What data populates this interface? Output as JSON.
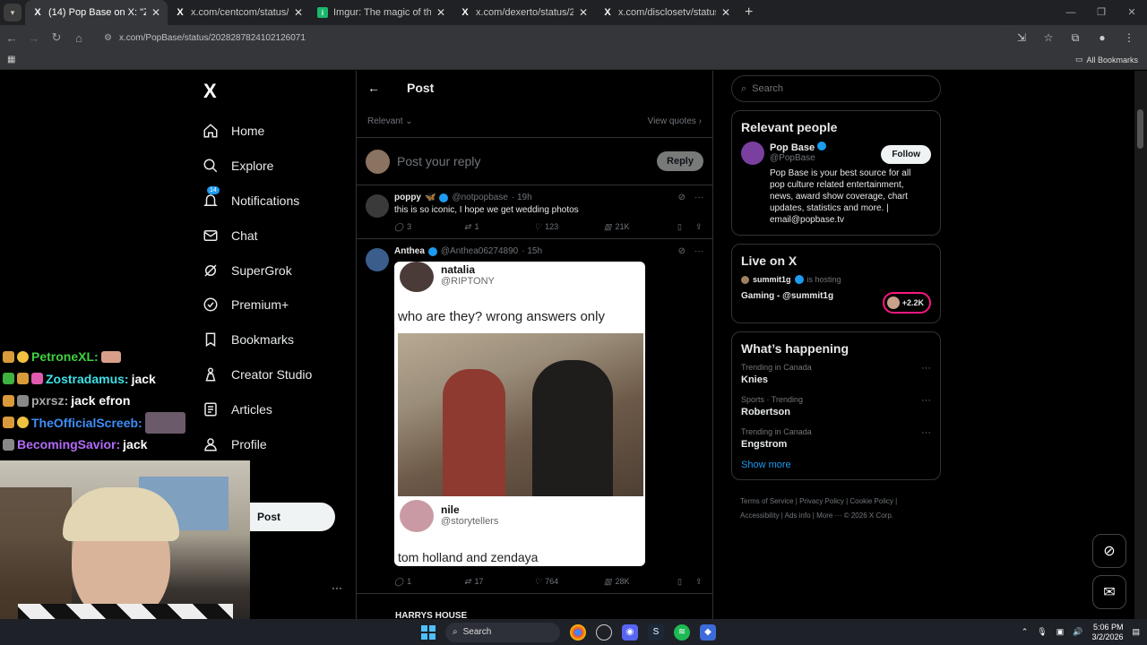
{
  "browser": {
    "tabs": [
      {
        "title": "(14) Pop Base on X: \"Zendaya a",
        "icon": "X",
        "active": true
      },
      {
        "title": "x.com/centcom/status/20285232",
        "icon": "X",
        "active": false
      },
      {
        "title": "Imgur: The magic of the Interne",
        "icon": "imgur",
        "active": false
      },
      {
        "title": "x.com/dexerto/status/20285838",
        "icon": "X",
        "active": false
      },
      {
        "title": "x.com/disclosetv/status/202858",
        "icon": "X",
        "active": false
      }
    ],
    "url": "x.com/PopBase/status/2028287824102126071",
    "all_bookmarks": "All Bookmarks"
  },
  "x": {
    "logo": "X",
    "nav": [
      {
        "label": "Home",
        "icon": "home-icon"
      },
      {
        "label": "Explore",
        "icon": "search-icon"
      },
      {
        "label": "Notifications",
        "icon": "bell-icon",
        "badge": "14"
      },
      {
        "label": "Chat",
        "icon": "mail-icon"
      },
      {
        "label": "SuperGrok",
        "icon": "grok-icon"
      },
      {
        "label": "Premium+",
        "icon": "premium-icon"
      },
      {
        "label": "Bookmarks",
        "icon": "bookmark-icon"
      },
      {
        "label": "Creator Studio",
        "icon": "creator-icon"
      },
      {
        "label": "Articles",
        "icon": "articles-icon"
      },
      {
        "label": "Profile",
        "icon": "profile-icon"
      },
      {
        "label": "re",
        "icon": "more-icon"
      }
    ],
    "post_button": "Post",
    "header": {
      "title": "Post"
    },
    "sort": {
      "relevant": "Relevant",
      "view_quotes": "View quotes"
    },
    "reply": {
      "placeholder": "Post your reply",
      "button": "Reply"
    },
    "tweets": [
      {
        "name": "poppy",
        "handle": "@notpopbase",
        "time": "· 19h",
        "text": "this is so iconic, I hope we get wedding photos",
        "replies": "3",
        "reposts": "1",
        "likes": "123",
        "views": "21K"
      },
      {
        "name": "Anthea",
        "handle": "@Anthea06274890",
        "time": "· 15h",
        "text": "",
        "embed": {
          "name1": "natalia",
          "handle1": "@RIPTONY",
          "question": "who are they? wrong answers only",
          "name2": "nile",
          "handle2": "@storytellers",
          "caption": "tom holland and zendaya"
        },
        "replies": "1",
        "reposts": "17",
        "likes": "764",
        "views": "28K"
      }
    ],
    "next_tweet_name": "HARRYS HOUSE",
    "search_placeholder": "Search",
    "relevant_people": {
      "title": "Relevant people",
      "name": "Pop Base",
      "handle": "@PopBase",
      "follow": "Follow",
      "bio": "Pop Base is your best source for all pop culture related entertainment, news, award show coverage, chart updates, statistics and more. | email@popbase.tv"
    },
    "live": {
      "title": "Live on X",
      "host": "summit1g",
      "hosting": "is hosting",
      "stream": "Gaming - @summit1g",
      "count": "+2.2K"
    },
    "happening": {
      "title": "What’s happening",
      "trends": [
        {
          "context": "Trending in Canada",
          "name": "Knies"
        },
        {
          "context": "Sports · Trending",
          "name": "Robertson"
        },
        {
          "context": "Trending in Canada",
          "name": "Engstrom"
        }
      ],
      "show_more": "Show more"
    },
    "footer": {
      "line1": "Terms of Service  |  Privacy Policy  |  Cookie Policy  |",
      "line2": "Accessibility  |  Ads info  |  More ···  © 2026 X Corp."
    }
  },
  "stream_chat": [
    {
      "user": "PetroneXL:",
      "msg": "",
      "color": "#3fd13f"
    },
    {
      "user": "Zostradamus:",
      "msg": "jack",
      "color": "#3ee0e6"
    },
    {
      "user": "pxrsz:",
      "msg": "jack efron",
      "color": "#a8a8a8"
    },
    {
      "user": "TheOfficialScreeb:",
      "msg": "",
      "color": "#3e8ef7"
    },
    {
      "user": "BecomingSavior:",
      "msg": "jack",
      "color": "#b26cf7"
    }
  ],
  "taskbar": {
    "search": "Search",
    "time": "5:06 PM",
    "date": "3/2/2026"
  }
}
